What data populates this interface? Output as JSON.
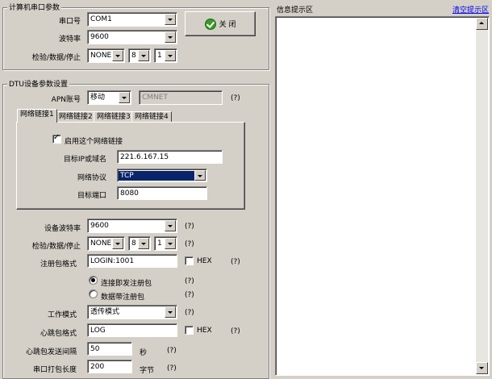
{
  "serial": {
    "legend": "计算机串口参数",
    "port_label": "串口号",
    "port_value": "COM1",
    "baud_label": "波特率",
    "baud_value": "9600",
    "parity_label": "检验/数据/停止",
    "parity_value": "NONE",
    "data_value": "8",
    "stop_value": "1",
    "close_button": "关 闭"
  },
  "dtu": {
    "legend": "DTU设备参数设置",
    "apn_label": "APN账号",
    "apn_value": "移动",
    "apn_name": "CMNET",
    "help": "(?)",
    "tabs": [
      "网络链接1",
      "网络链接2",
      "网络链接3",
      "网络链接4"
    ],
    "enable_label": "启用这个网络链接",
    "ip_label": "目标IP或域名",
    "ip_value": "221.6.167.15",
    "protocol_label": "网络协议",
    "protocol_value": "TCP",
    "port_label": "目标端口",
    "port_value": "8080",
    "dev_baud_label": "设备波特率",
    "dev_baud_value": "9600",
    "dev_parity_label": "检验/数据/停止",
    "dev_parity_value": "NONE",
    "dev_data_value": "8",
    "dev_stop_value": "1",
    "reg_label": "注册包格式",
    "reg_value": "LOGIN:1001",
    "hex_label": "HEX",
    "radio_connect": "连接即发注册包",
    "radio_data": "数据带注册包",
    "mode_label": "工作模式",
    "mode_value": "透传模式",
    "heartbeat_label": "心跳包格式",
    "heartbeat_value": "LOG",
    "hb_interval_label": "心跳包发送间隔",
    "hb_interval_value": "50",
    "sec_unit": "秒",
    "pack_len_label": "串口打包长度",
    "pack_len_value": "200",
    "byte_unit": "字节"
  },
  "info": {
    "title": "信息提示区",
    "clear_link": "清空提示区"
  }
}
